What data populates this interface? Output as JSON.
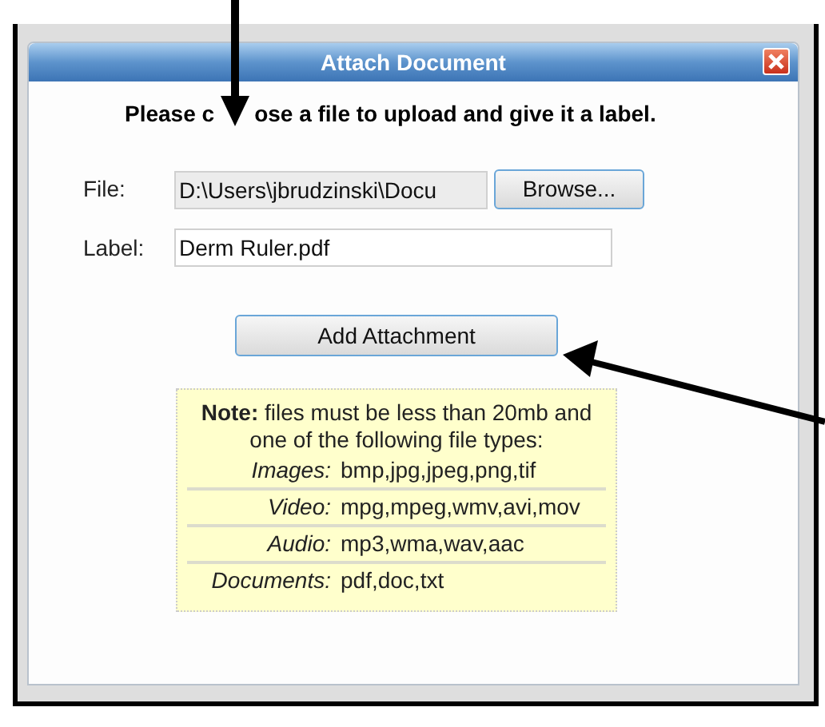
{
  "dialog": {
    "title": "Attach Document",
    "instruction_parts": [
      "Please c",
      "ose a file to upload and give it a label."
    ],
    "fields": [
      {
        "kind": "file",
        "label": "File:",
        "value": "D:\\Users\\jbrudzinski\\Docu",
        "button": "Browse..."
      },
      {
        "kind": "text",
        "label": "Label:",
        "value": "Derm Ruler.pdf"
      }
    ],
    "submit_button": "Add Attachment",
    "note": {
      "text": "**Note:** files must be less than 20mb and one of the following file types:",
      "file_types": [
        {
          "category": "Images:",
          "extensions": "bmp,jpg,jpeg,png,tif"
        },
        {
          "category": "Video:",
          "extensions": "mpg,mpeg,wmv,avi,mov"
        },
        {
          "category": "Audio:",
          "extensions": "mp3,wma,wav,aac"
        },
        {
          "category": "Documents:",
          "extensions": "pdf,doc,txt"
        }
      ]
    }
  }
}
